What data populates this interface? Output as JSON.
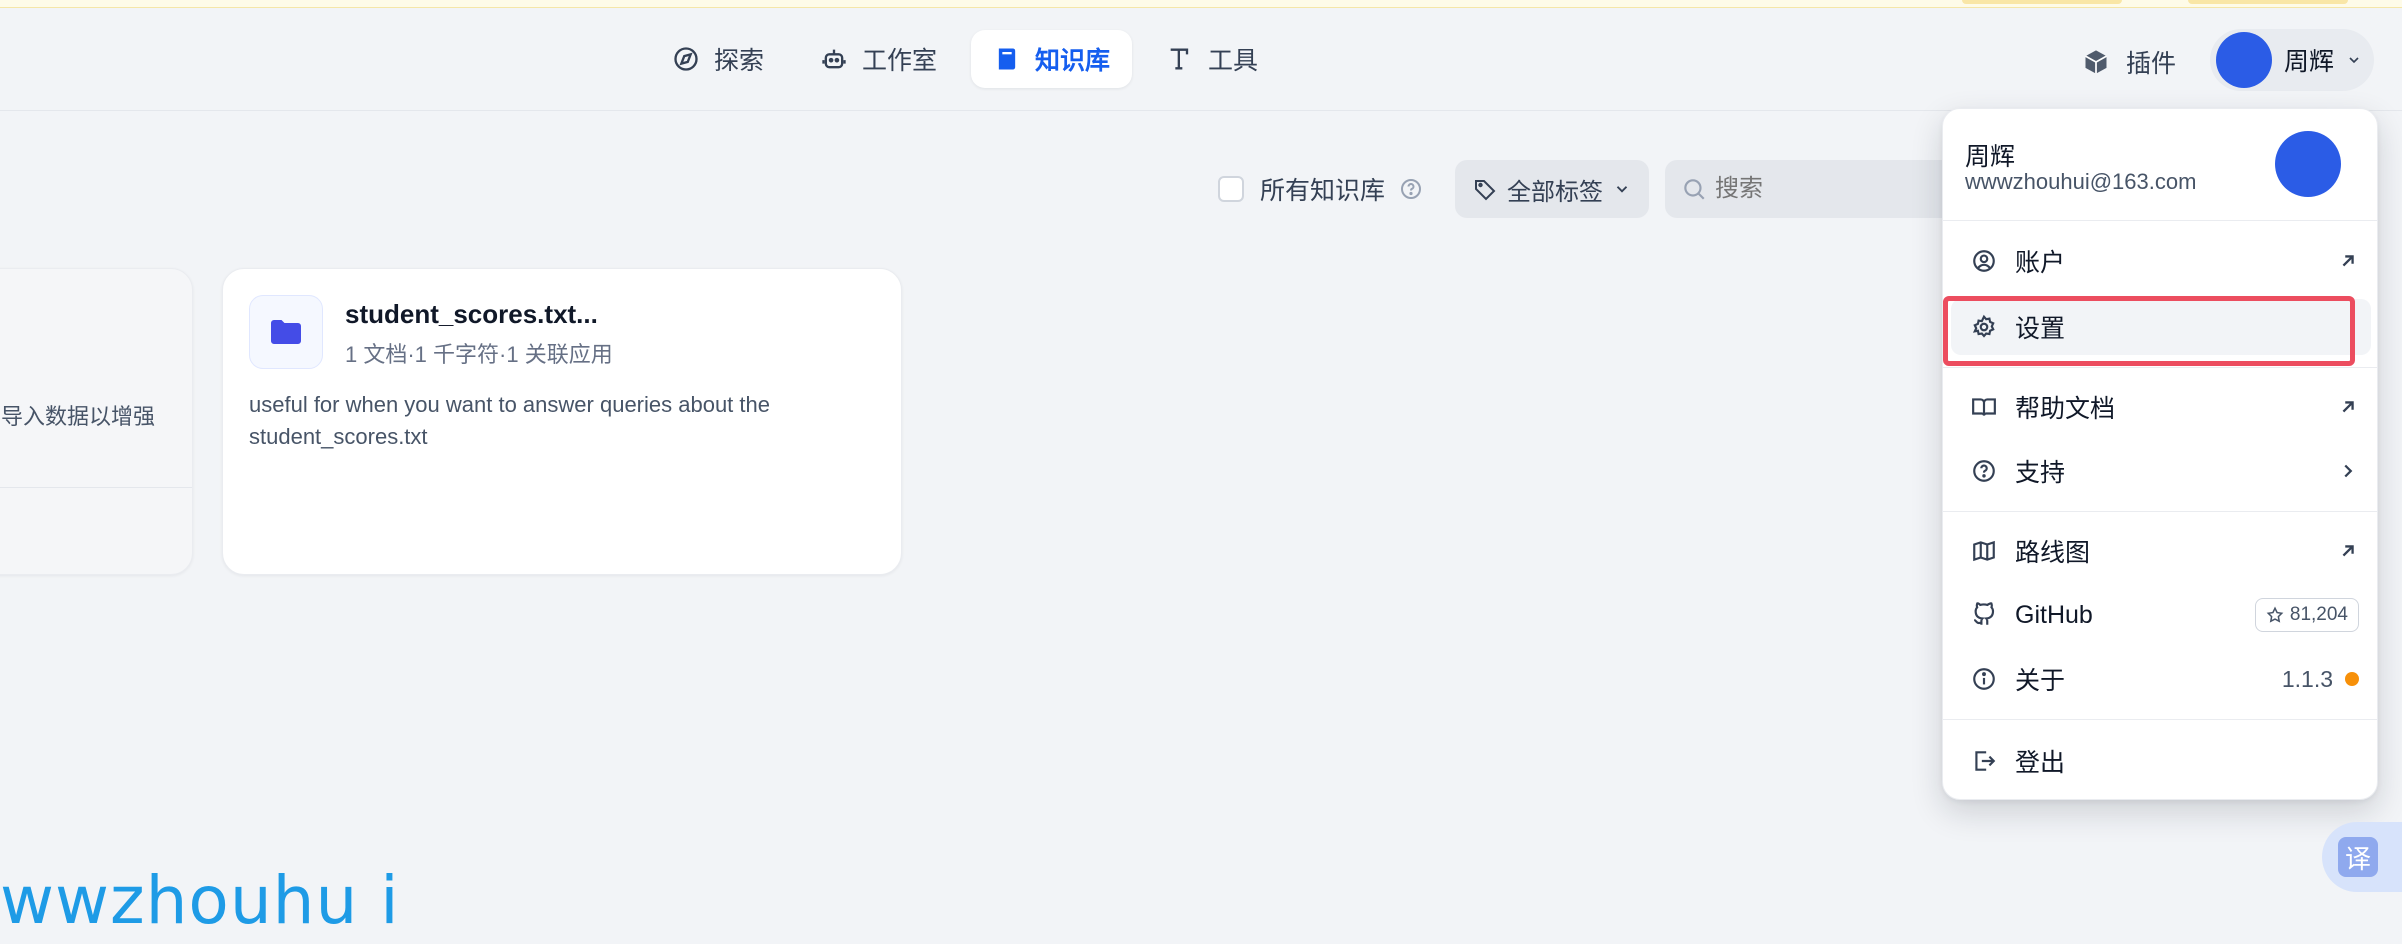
{
  "nav": {
    "items": [
      {
        "label": "探索",
        "icon": "compass-icon",
        "active": false
      },
      {
        "label": "工作室",
        "icon": "robot-icon",
        "active": false
      },
      {
        "label": "知识库",
        "icon": "book-icon",
        "active": true
      },
      {
        "label": "工具",
        "icon": "tools-icon",
        "active": false
      }
    ]
  },
  "header": {
    "plugins_label": "插件",
    "user_name": "周辉"
  },
  "toolbar": {
    "all_kb_label": "所有知识库",
    "tags_label": "全部标签",
    "search_placeholder": "搜索"
  },
  "cards": {
    "left_desc": "导入数据以增强",
    "main": {
      "title": "student_scores.txt...",
      "meta": "1 文档·1 千字符·1 关联应用",
      "desc": "useful for when you want to answer queries about the student_scores.txt"
    }
  },
  "dropdown": {
    "name": "周辉",
    "email": "wwwzhouhui@163.com",
    "items": {
      "account": "账户",
      "settings": "设置",
      "help": "帮助文档",
      "support": "支持",
      "roadmap": "路线图",
      "github": "GitHub",
      "github_stars": "81,204",
      "about": "关于",
      "version": "1.1.3",
      "logout": "登出"
    }
  },
  "watermark": "wwzhouhu i",
  "translate_label": "译",
  "colors": {
    "accent": "#155eef",
    "avatar": "#2b5ce6",
    "highlight": "#ec4d5f",
    "status_dot": "#f79009",
    "watermark": "#1e9be6"
  }
}
